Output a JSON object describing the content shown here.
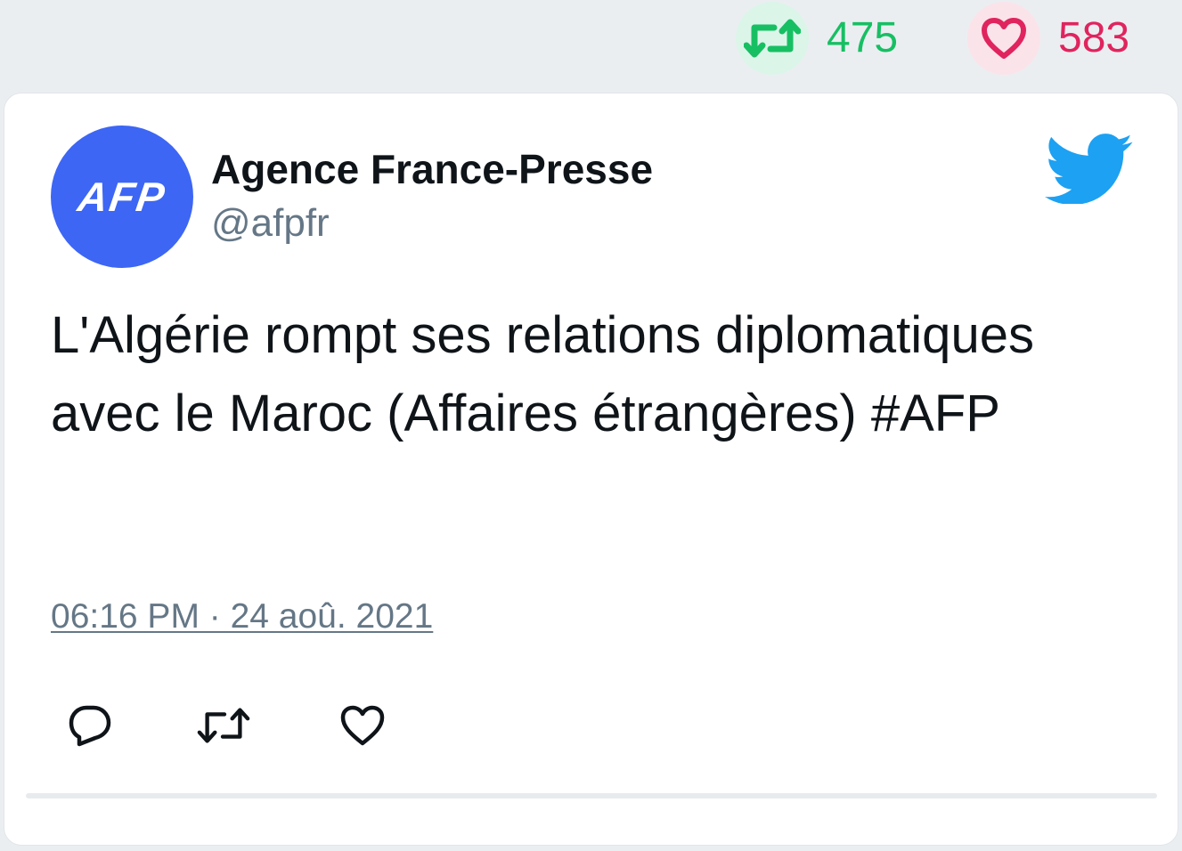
{
  "stats": {
    "retweets": "475",
    "likes": "583",
    "retweet_icon": "retweet-icon",
    "like_icon": "heart-icon",
    "retweet_color": "#17bf63",
    "like_color": "#e0245e"
  },
  "tweet": {
    "author_name": "Agence France-Presse",
    "author_handle": "@afpfr",
    "avatar_text": "AFP",
    "avatar_color": "#3d66f4",
    "text": "L'Algérie rompt ses relations diplomatiques avec le Maroc (Affaires étrangères) #AFP",
    "timestamp": "06:16 PM · 24 aoû. 2021",
    "brand_icon": "twitter-bird-icon",
    "brand_color": "#1da1f2"
  },
  "actions": {
    "reply_icon": "reply-icon",
    "retweet_icon": "retweet-icon",
    "like_icon": "heart-icon"
  }
}
